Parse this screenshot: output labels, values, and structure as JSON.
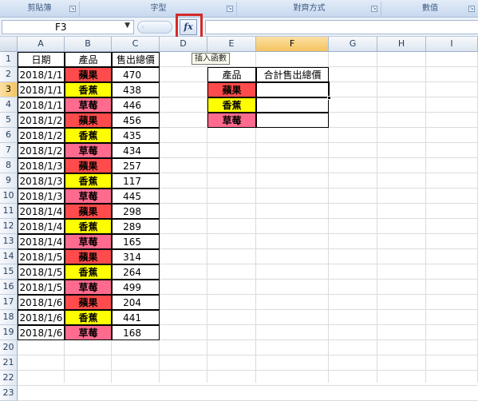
{
  "ribbon": {
    "groups": [
      {
        "label": "剪貼簿"
      },
      {
        "label": "字型"
      },
      {
        "label": "對齊方式"
      },
      {
        "label": "數值"
      }
    ]
  },
  "formula_bar": {
    "name_box": "F3",
    "fx_label": "fx",
    "formula": ""
  },
  "tooltip": "插入函數",
  "columns": [
    "A",
    "B",
    "C",
    "D",
    "E",
    "F",
    "G",
    "H",
    "I"
  ],
  "selected_column": "F",
  "selected_row": "3",
  "rows": [
    "1",
    "2",
    "3",
    "4",
    "5",
    "6",
    "7",
    "8",
    "9",
    "10",
    "11",
    "12",
    "13",
    "14",
    "15",
    "16",
    "17",
    "18",
    "19",
    "20",
    "21",
    "22",
    "23"
  ],
  "colors": {
    "apple": "#ff4b4b",
    "banana": "#ffff00",
    "strawberry": "#ff6b8e",
    "highlight_box": "#d42a2a",
    "selected_header": "#f5c35e"
  },
  "table_headers": {
    "date": "日期",
    "product": "產品",
    "sales": "售出總價"
  },
  "table_rows": [
    {
      "date": "2018/1/1",
      "product": "蘋果",
      "kind": "apple",
      "sales": "470"
    },
    {
      "date": "2018/1/1",
      "product": "香蕉",
      "kind": "banana",
      "sales": "438"
    },
    {
      "date": "2018/1/1",
      "product": "草莓",
      "kind": "strawberry",
      "sales": "446"
    },
    {
      "date": "2018/1/2",
      "product": "蘋果",
      "kind": "apple",
      "sales": "456"
    },
    {
      "date": "2018/1/2",
      "product": "香蕉",
      "kind": "banana",
      "sales": "435"
    },
    {
      "date": "2018/1/2",
      "product": "草莓",
      "kind": "strawberry",
      "sales": "434"
    },
    {
      "date": "2018/1/3",
      "product": "蘋果",
      "kind": "apple",
      "sales": "257"
    },
    {
      "date": "2018/1/3",
      "product": "香蕉",
      "kind": "banana",
      "sales": "117"
    },
    {
      "date": "2018/1/3",
      "product": "草莓",
      "kind": "strawberry",
      "sales": "445"
    },
    {
      "date": "2018/1/4",
      "product": "蘋果",
      "kind": "apple",
      "sales": "298"
    },
    {
      "date": "2018/1/4",
      "product": "香蕉",
      "kind": "banana",
      "sales": "289"
    },
    {
      "date": "2018/1/4",
      "product": "草莓",
      "kind": "strawberry",
      "sales": "165"
    },
    {
      "date": "2018/1/5",
      "product": "蘋果",
      "kind": "apple",
      "sales": "314"
    },
    {
      "date": "2018/1/5",
      "product": "香蕉",
      "kind": "banana",
      "sales": "264"
    },
    {
      "date": "2018/1/5",
      "product": "草莓",
      "kind": "strawberry",
      "sales": "499"
    },
    {
      "date": "2018/1/6",
      "product": "蘋果",
      "kind": "apple",
      "sales": "204"
    },
    {
      "date": "2018/1/6",
      "product": "香蕉",
      "kind": "banana",
      "sales": "441"
    },
    {
      "date": "2018/1/6",
      "product": "草莓",
      "kind": "strawberry",
      "sales": "168"
    }
  ],
  "summary_headers": {
    "product": "產品",
    "total": "合計售出總價"
  },
  "summary_rows": [
    {
      "product": "蘋果",
      "kind": "apple",
      "total": ""
    },
    {
      "product": "香蕉",
      "kind": "banana",
      "total": ""
    },
    {
      "product": "草莓",
      "kind": "strawberry",
      "total": ""
    }
  ]
}
